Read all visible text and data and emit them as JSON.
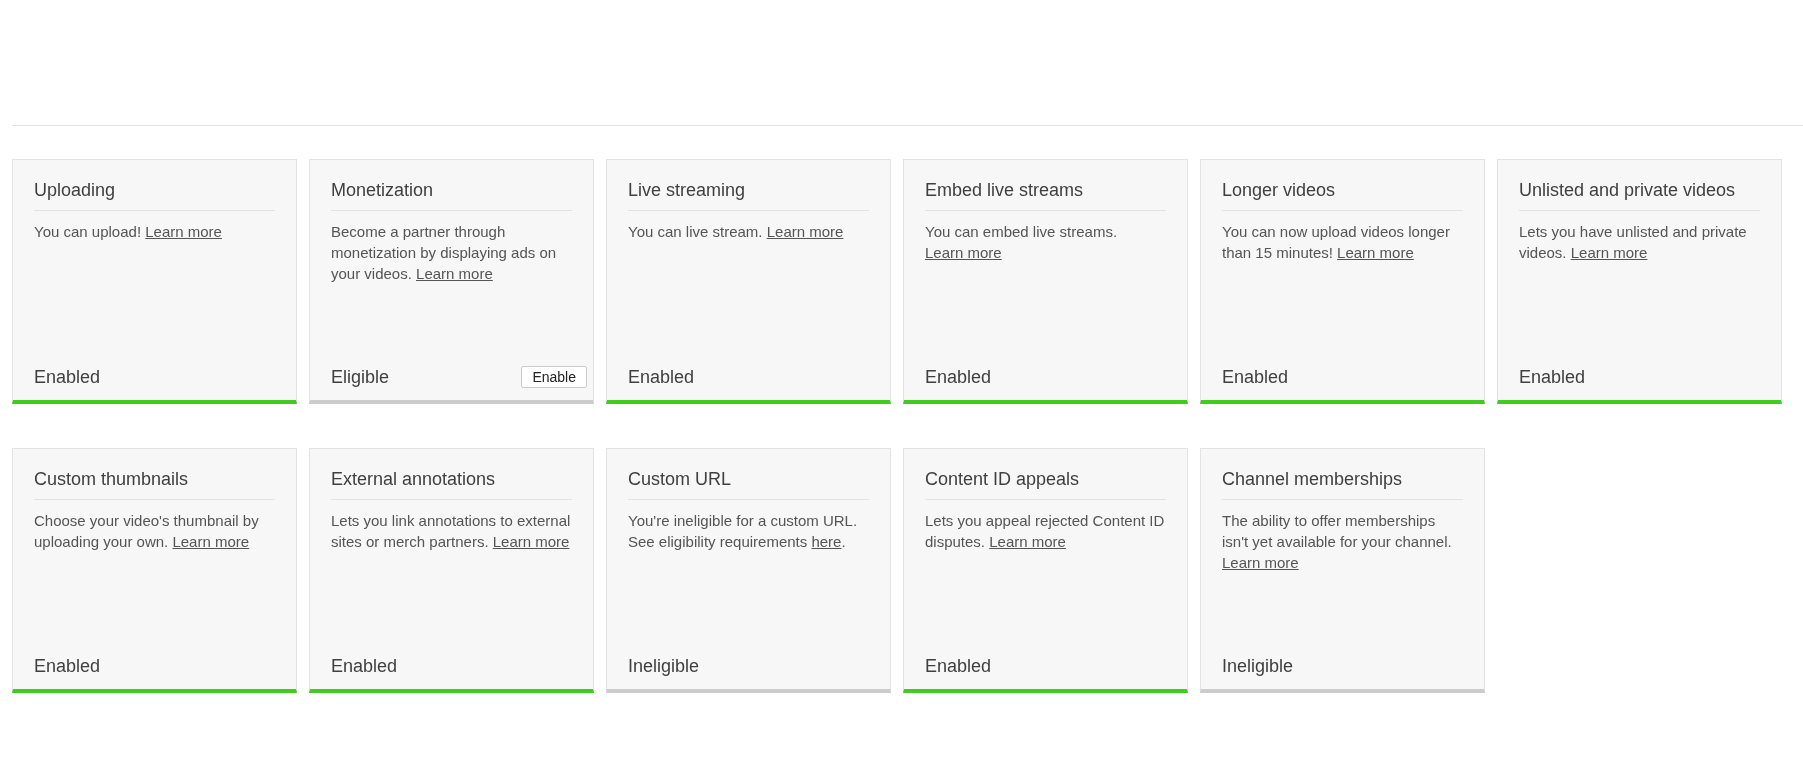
{
  "features": [
    {
      "title": "Uploading",
      "description": "You can upload!",
      "link": "Learn more",
      "status": "Enabled",
      "enabled": true
    },
    {
      "title": "Monetization",
      "description": "Become a partner through monetization by displaying ads on your videos.",
      "link": "Learn more",
      "status": "Eligible",
      "enabled": false,
      "button": "Enable"
    },
    {
      "title": "Live streaming",
      "description": "You can live stream.",
      "link": "Learn more",
      "status": "Enabled",
      "enabled": true
    },
    {
      "title": "Embed live streams",
      "description": "You can embed live streams.",
      "link": "Learn more",
      "status": "Enabled",
      "enabled": true
    },
    {
      "title": "Longer videos",
      "description": "You can now upload videos longer than 15 minutes!",
      "link": "Learn more",
      "status": "Enabled",
      "enabled": true
    },
    {
      "title": "Unlisted and private videos",
      "description": "Lets you have unlisted and private videos.",
      "link": "Learn more",
      "status": "Enabled",
      "enabled": true
    },
    {
      "title": "Custom thumbnails",
      "description": "Choose your video's thumbnail by uploading your own.",
      "link": "Learn more",
      "status": "Enabled",
      "enabled": true
    },
    {
      "title": "External annotations",
      "description": "Lets you link annotations to external sites or merch partners.",
      "link": "Learn more",
      "status": "Enabled",
      "enabled": true
    },
    {
      "title": "Custom URL",
      "description": "You're ineligible for a custom URL. See eligibility requirements",
      "link": "here",
      "suffix": ".",
      "status": "Ineligible",
      "enabled": false
    },
    {
      "title": "Content ID appeals",
      "description": "Lets you appeal rejected Content ID disputes.",
      "link": "Learn more",
      "status": "Enabled",
      "enabled": true
    },
    {
      "title": "Channel memberships",
      "description": "The ability to offer memberships isn't yet available for your channel.",
      "link": "Learn more",
      "status": "Ineligible",
      "enabled": false
    }
  ]
}
